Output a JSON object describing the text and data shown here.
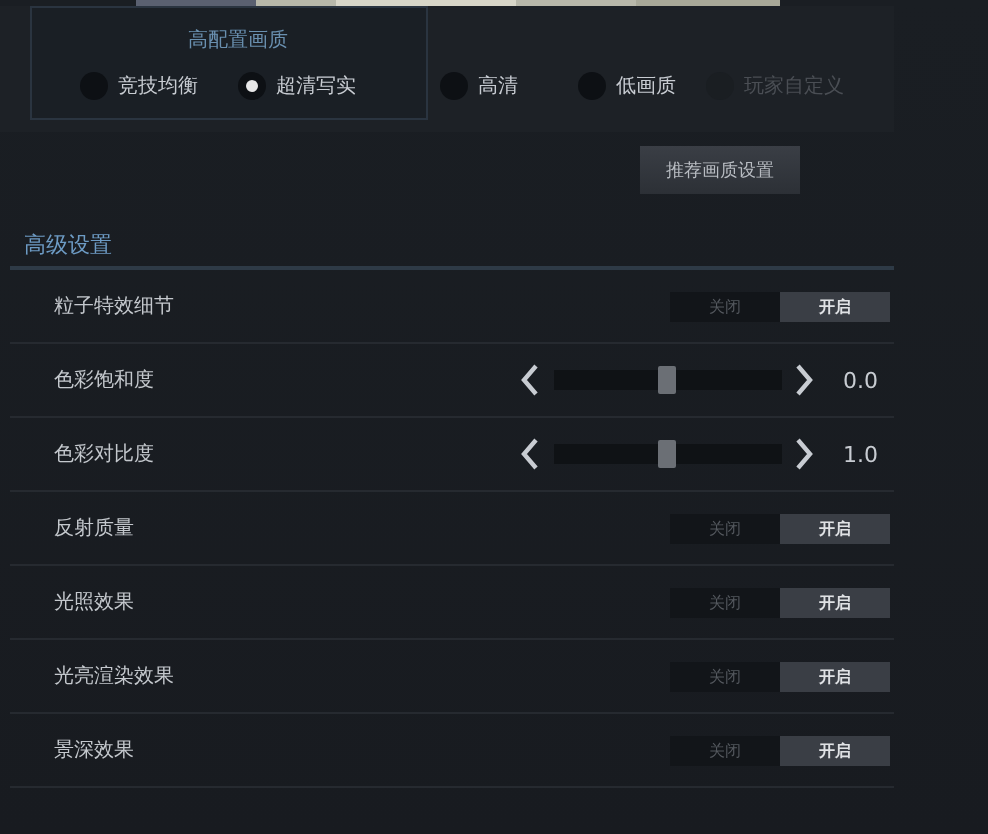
{
  "quality_group": {
    "title": "高配置画质"
  },
  "presets": [
    {
      "label": "竞技均衡",
      "selected": false,
      "disabled": false
    },
    {
      "label": "超清写实",
      "selected": true,
      "disabled": false
    },
    {
      "label": "高清",
      "selected": false,
      "disabled": false
    },
    {
      "label": "低画质",
      "selected": false,
      "disabled": false
    },
    {
      "label": "玩家自定义",
      "selected": false,
      "disabled": true
    }
  ],
  "recommend_button": "推荐画质设置",
  "section_title": "高级设置",
  "settings": [
    {
      "kind": "toggle",
      "label": "粒子特效细节",
      "off_label": "关闭",
      "on_label": "开启",
      "on": true
    },
    {
      "kind": "slider",
      "label": "色彩饱和度",
      "level": 0.5,
      "reading": "0.0"
    },
    {
      "kind": "slider",
      "label": "色彩对比度",
      "level": 0.5,
      "reading": "1.0"
    },
    {
      "kind": "toggle",
      "label": "反射质量",
      "off_label": "关闭",
      "on_label": "开启",
      "on": true
    },
    {
      "kind": "toggle",
      "label": "光照效果",
      "off_label": "关闭",
      "on_label": "开启",
      "on": true
    },
    {
      "kind": "toggle",
      "label": "光亮渲染效果",
      "off_label": "关闭",
      "on_label": "开启",
      "on": true
    },
    {
      "kind": "toggle",
      "label": "景深效果",
      "off_label": "关闭",
      "on_label": "开启",
      "on": true
    }
  ]
}
